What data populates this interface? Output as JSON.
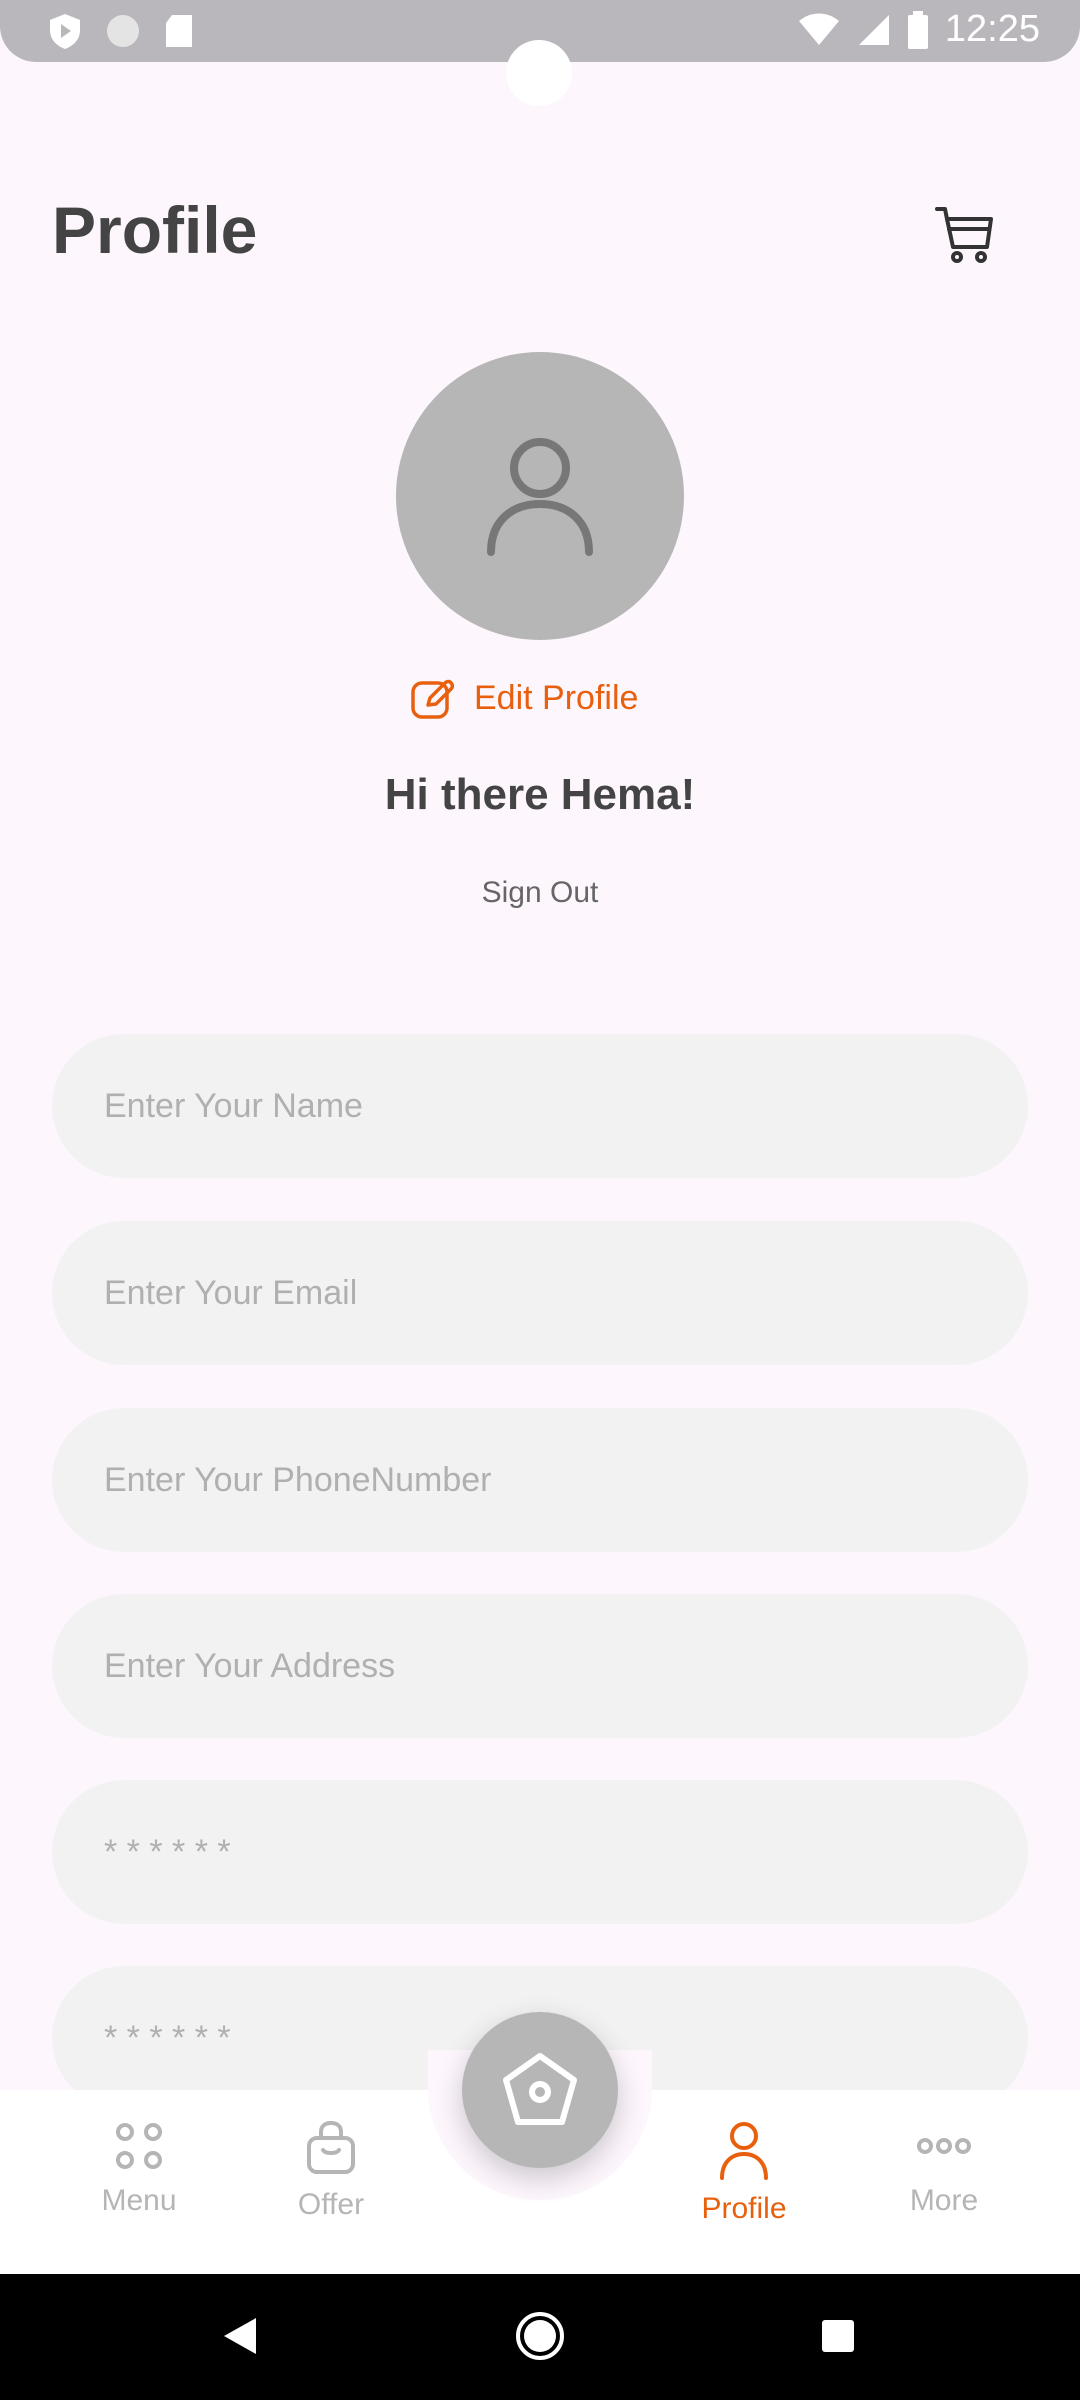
{
  "status_bar": {
    "time": "12:25"
  },
  "header": {
    "title": "Profile"
  },
  "profile": {
    "edit_label": "Edit Profile",
    "greeting": "Hi there Hema!",
    "sign_out": "Sign Out"
  },
  "form": {
    "name_placeholder": "Enter Your Name",
    "email_placeholder": "Enter Your Email",
    "phone_placeholder": "Enter Your PhoneNumber",
    "address_placeholder": "Enter Your Address",
    "password_placeholder": "* * * * * *",
    "confirm_password_placeholder": "* * * * * *"
  },
  "bottom_nav": {
    "items": [
      {
        "label": "Menu",
        "icon": "menu-grid-icon"
      },
      {
        "label": "Offer",
        "icon": "shopping-bag-icon"
      },
      {
        "label": "Profile",
        "icon": "person-icon",
        "active": true
      },
      {
        "label": "More",
        "icon": "more-dots-icon"
      }
    ],
    "center_icon": "home-icon"
  },
  "colors": {
    "accent": "#e8600e",
    "background": "#fdf7fd",
    "field": "#f2f2f2",
    "avatar": "#b5b6b5"
  }
}
